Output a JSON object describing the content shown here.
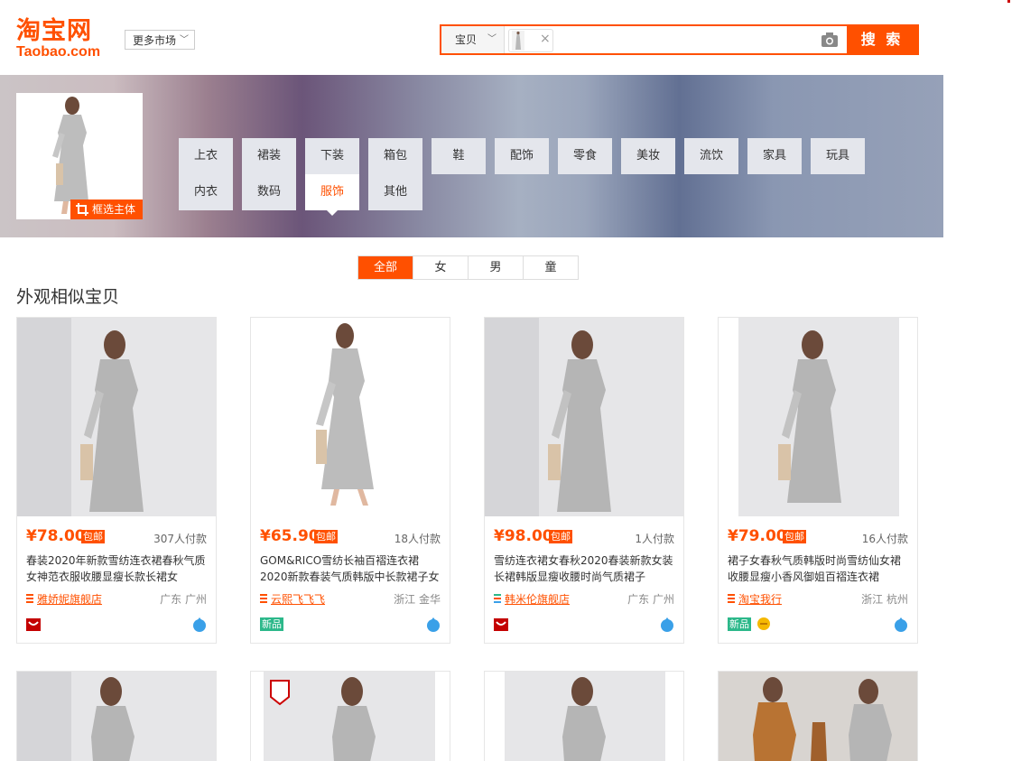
{
  "header": {
    "logo_cn": "淘宝网",
    "logo_en": "Taobao.com",
    "more_market": "更多市场",
    "search": {
      "category": "宝贝",
      "button": "搜 索"
    }
  },
  "image_panel": {
    "crop_label": "框选主体"
  },
  "categories": [
    "上衣",
    "裙装",
    "下装",
    "箱包",
    "鞋",
    "配饰",
    "零食",
    "美妆",
    "流饮",
    "家具",
    "玩具",
    "内衣",
    "数码",
    "服饰",
    "其他"
  ],
  "active_category": "服饰",
  "gender_tabs": [
    "全部",
    "女",
    "男",
    "童"
  ],
  "active_gender": "全部",
  "section_title": "外观相似宝贝",
  "products": [
    {
      "price": "¥78.00",
      "baoyou": "包邮",
      "sales": "307人付款",
      "title": "春装2020年新款雪纺连衣裙春秋气质女神范衣服收腰显瘦长款长裙女",
      "shop": "雅娇妮旗舰店",
      "loc": "广东 广州"
    },
    {
      "price": "¥65.90",
      "baoyou": "包邮",
      "sales": "18人付款",
      "title": "GOM&RICO雪纺长袖百褶连衣裙2020新款春装气质韩版中长款裙子女",
      "shop": "云熙飞飞飞",
      "loc": "浙江 金华",
      "tag": "新品"
    },
    {
      "price": "¥98.00",
      "baoyou": "包邮",
      "sales": "1人付款",
      "title": "雪纺连衣裙女春秋2020春装新款女装长裙韩版显瘦收腰时尚气质裙子",
      "shop": "韩米伦旗舰店",
      "loc": "广东 广州"
    },
    {
      "price": "¥79.00",
      "baoyou": "包邮",
      "sales": "16人付款",
      "title": "裙子女春秋气质韩版时尚雪纺仙女裙收腰显瘦小香风御姐百褶连衣裙",
      "shop": "淘宝我行",
      "loc": "浙江 杭州",
      "tag": "新品"
    }
  ],
  "colors": {
    "accent": "#ff5000",
    "new_tag": "#2cb88a",
    "drop": "#3aa0e8"
  }
}
